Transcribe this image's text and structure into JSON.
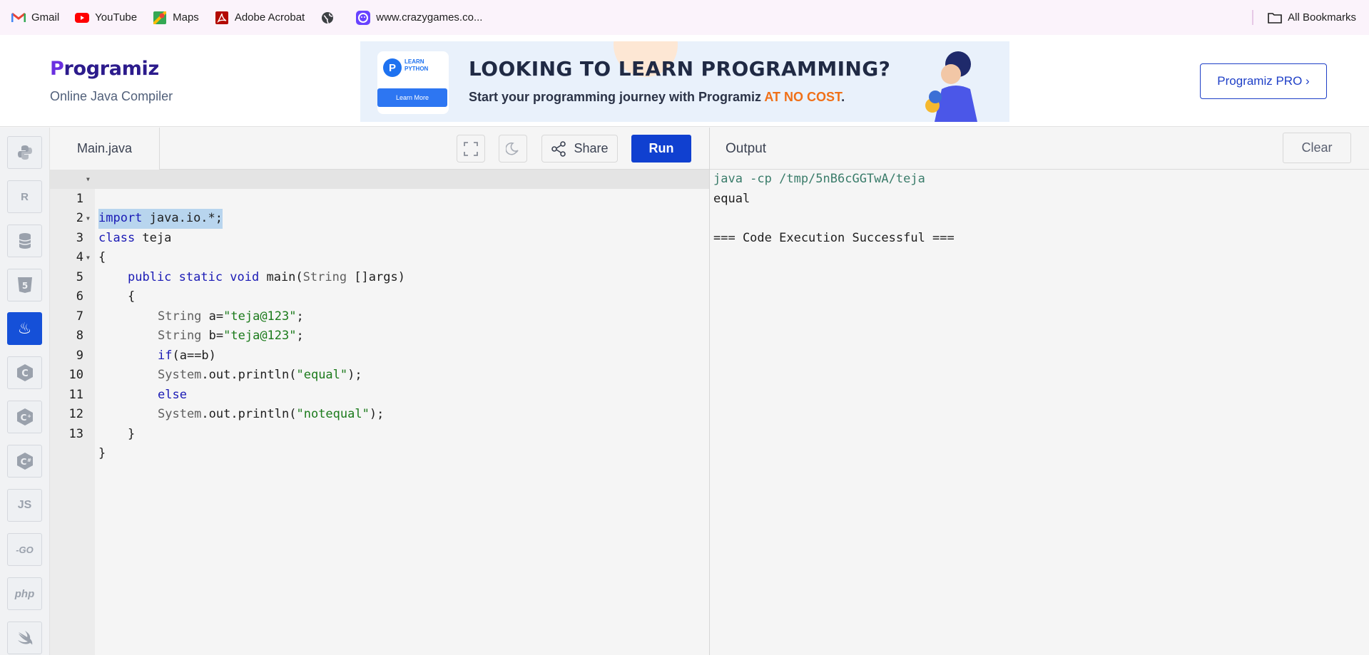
{
  "bookmarks": {
    "items": [
      {
        "label": "Gmail",
        "icon": "gmail-icon"
      },
      {
        "label": "YouTube",
        "icon": "youtube-icon"
      },
      {
        "label": "Maps",
        "icon": "maps-icon"
      },
      {
        "label": "Adobe Acrobat",
        "icon": "acrobat-icon"
      },
      {
        "label": "",
        "icon": "globe-icon"
      },
      {
        "label": "www.crazygames.co...",
        "icon": "crazygames-icon"
      }
    ],
    "all_bookmarks": "All Bookmarks"
  },
  "header": {
    "logo_first": "P",
    "logo_rest": "rogramiz",
    "subtitle": "Online Java Compiler",
    "pro_button": "Programiz PRO ›"
  },
  "banner": {
    "card_label": "LEARN PYTHON",
    "card_button": "Learn More",
    "heading": "LOOKING TO LEARN PROGRAMMING?",
    "sub_text": "Start your programming journey with Programiz ",
    "sub_accent": "AT NO COST",
    "sub_end": "."
  },
  "sidebar": {
    "languages": [
      {
        "name": "python",
        "glyph": ""
      },
      {
        "name": "r",
        "glyph": "R"
      },
      {
        "name": "sql",
        "glyph": ""
      },
      {
        "name": "html",
        "glyph": "5"
      },
      {
        "name": "java",
        "glyph": "♨",
        "active": true
      },
      {
        "name": "c",
        "glyph": "C"
      },
      {
        "name": "cpp",
        "glyph": "C"
      },
      {
        "name": "csharp",
        "glyph": "C"
      },
      {
        "name": "javascript",
        "glyph": "JS"
      },
      {
        "name": "go",
        "glyph": "-GO"
      },
      {
        "name": "php",
        "glyph": "php"
      },
      {
        "name": "swift",
        "glyph": ""
      }
    ]
  },
  "editor": {
    "tab_name": "Main.java",
    "share_label": "Share",
    "run_label": "Run",
    "lines": [
      {
        "n": "1",
        "fold": true
      },
      {
        "n": "2"
      },
      {
        "n": "3",
        "fold": true
      },
      {
        "n": "4"
      },
      {
        "n": "5",
        "fold": true
      },
      {
        "n": "6"
      },
      {
        "n": "7"
      },
      {
        "n": "8"
      },
      {
        "n": "9"
      },
      {
        "n": "10"
      },
      {
        "n": "11"
      },
      {
        "n": "12"
      },
      {
        "n": "13"
      }
    ],
    "code": {
      "l1_kw": "import",
      "l1_rest": " java.io.*;",
      "l2_kw": "class",
      "l2_rest": " teja",
      "l3": "{",
      "l4_a": "public static void",
      "l4_b": " main(",
      "l4_c": "String",
      "l4_d": " []args)",
      "l5": "{",
      "l6_t": "String",
      "l6_a": " a=",
      "l6_s": "\"teja@123\"",
      "l6_e": ";",
      "l7_t": "String",
      "l7_a": " b=",
      "l7_s": "\"teja@123\"",
      "l7_e": ";",
      "l8_kw": "if",
      "l8_rest": "(a==b)",
      "l9_t": "System",
      "l9_a": ".out.println(",
      "l9_s": "\"equal\"",
      "l9_e": ");",
      "l10_kw": "else",
      "l11_t": "System",
      "l11_a": ".out.println(",
      "l11_s": "\"notequal\"",
      "l11_e": ");",
      "l12": "}",
      "l13": "}"
    }
  },
  "output": {
    "title": "Output",
    "clear_label": "Clear",
    "cmd": "java -cp /tmp/5nB6cGGTwA/teja",
    "result": "equal",
    "status": "=== Code Execution Successful ==="
  },
  "colors": {
    "run_button": "#1040d0",
    "active_language": "#1550d8",
    "keyword": "#1a1ab5",
    "string": "#1b7a1b"
  }
}
